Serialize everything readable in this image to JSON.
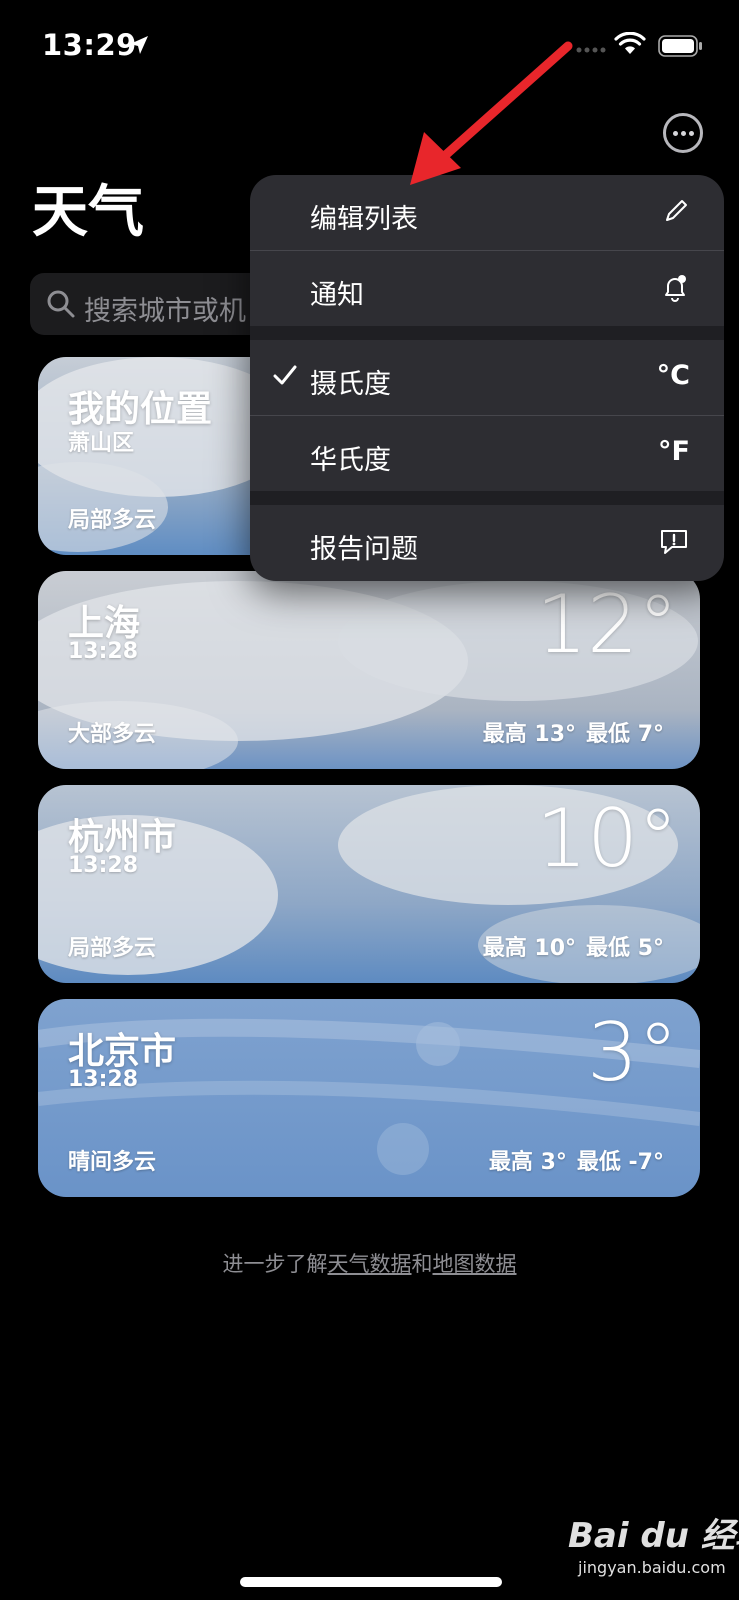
{
  "status_bar": {
    "time": "13:29"
  },
  "header": {
    "title": "天气"
  },
  "search": {
    "placeholder": "搜索城市或机"
  },
  "cards": [
    {
      "city": "我的位置",
      "subtitle": "萧山区",
      "condition": "局部多云"
    },
    {
      "city": "上海",
      "subtitle": "13:28",
      "condition": "大部多云",
      "temp": "12°",
      "high": "最高 13°",
      "low": "最低 7°"
    },
    {
      "city": "杭州市",
      "subtitle": "13:28",
      "condition": "局部多云",
      "temp": "10°",
      "high": "最高 10°",
      "low": "最低 5°"
    },
    {
      "city": "北京市",
      "subtitle": "13:28",
      "condition": "晴间多云",
      "temp": "3°",
      "high": "最高 3°",
      "low": "最低 -7°"
    }
  ],
  "footer": {
    "prefix": "进一步了解",
    "link1": "天气数据",
    "middle": "和",
    "link2": "地图数据"
  },
  "menu": {
    "items": [
      {
        "label": "编辑列表",
        "icon": "pencil-icon"
      },
      {
        "label": "通知",
        "icon": "bell-icon"
      },
      {
        "label": "摄氏度",
        "right": "°C",
        "checked": true
      },
      {
        "label": "华氏度",
        "right": "°F"
      },
      {
        "label": "报告问题",
        "icon": "report-bubble-icon"
      }
    ]
  },
  "watermark": {
    "logo": "Bai du 经验",
    "url": "jingyan.baidu.com"
  },
  "colors": {
    "annotation_arrow": "#e8262b",
    "menu_bg": "#2d2d32",
    "card_sky": "#6c95c8"
  }
}
